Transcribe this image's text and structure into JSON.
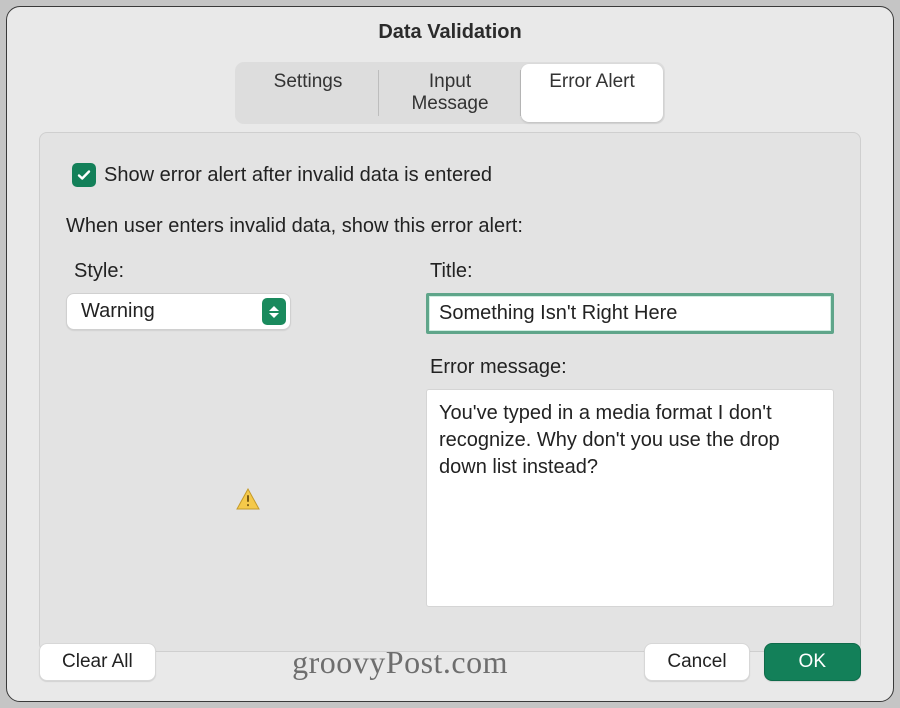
{
  "title": "Data Validation",
  "tabs": {
    "settings": "Settings",
    "input_message": "Input Message",
    "error_alert": "Error Alert"
  },
  "checkbox_label": "Show error alert after invalid data is entered",
  "instruction": "When user enters invalid data, show this error alert:",
  "style": {
    "label": "Style:",
    "value": "Warning"
  },
  "title_field": {
    "label": "Title:",
    "value": "Something Isn't Right Here"
  },
  "error_message": {
    "label": "Error message:",
    "value": "You've typed in a media format I don't recognize. Why don't you use the drop down list instead?"
  },
  "buttons": {
    "clear_all": "Clear All",
    "cancel": "Cancel",
    "ok": "OK"
  },
  "watermark": "groovyPost.com",
  "colors": {
    "accent": "#138059"
  }
}
